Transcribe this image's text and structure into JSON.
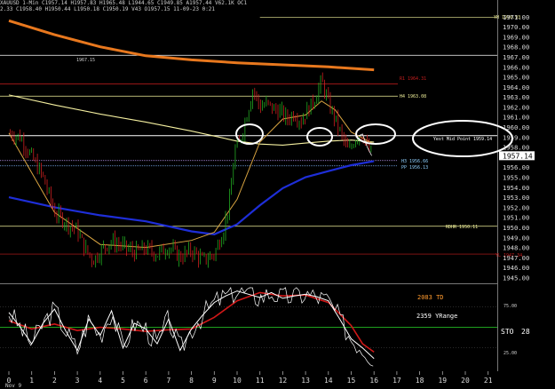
{
  "header": {
    "line1": "XAUUSD 1-Min C1957.14 H1957.83 H1965.48 L1944.65 C1949.85 A1957.44 V62.1K OC1",
    "line2": "2.33 C1958.40 H1950.44 L1950.18 C1950.19 V43 O1957.15 11-09-23 0:21"
  },
  "price_axis": {
    "ticks": [
      "1971.00",
      "1970.00",
      "1969.00",
      "1968.00",
      "1967.00",
      "1966.00",
      "1965.00",
      "1964.00",
      "1963.00",
      "1962.00",
      "1961.00",
      "1960.00",
      "1959.00",
      "1958.00",
      "1957.14",
      "1956.00",
      "1955.00",
      "1954.00",
      "1953.00",
      "1952.00",
      "1951.00",
      "1950.00",
      "1949.00",
      "1948.00",
      "1947.00",
      "1946.00",
      "1945.00"
    ],
    "current": "1957.14"
  },
  "levels": {
    "yh": "YH 1970.93",
    "r1": "R1 1964.31",
    "h4": "H4 1963.08",
    "h3": "H3 1956.66",
    "pp": "PP 1956.13",
    "rdhr": "RDHR 1950.11",
    "yl": "YL 1947.34",
    "annot_left": "1967.15"
  },
  "callouts": {
    "mid_point": "Yest Mid Point 1959.14"
  },
  "oscillator": {
    "td": "2083 TD",
    "range": "2359 YRange",
    "label": "STO",
    "label_suffix": "28",
    "ticks": [
      "75.00",
      "25.00"
    ]
  },
  "time_axis": {
    "ticks": [
      "0",
      "1",
      "2",
      "3",
      "4",
      "5",
      "6",
      "7",
      "8",
      "9",
      "10",
      "11",
      "12",
      "13",
      "14",
      "15",
      "16",
      "17",
      "18",
      "19",
      "20",
      "21"
    ],
    "bottom_label": "Nov 9"
  },
  "colors": {
    "background": "#000000",
    "price": "#ffffff",
    "up_bar": "#22aa22",
    "down_bar": "#cc2020",
    "ma_orange": "#e8781e",
    "ma_yellow": "#f5f0a0",
    "ma_blue": "#1e2ed8",
    "sma_gold": "#d9a441",
    "level_red": "#c81e1e",
    "level_yellow": "#f0f09a",
    "level_white": "#ffffff",
    "grid": "#1a1a1a",
    "stoch_k": "#ffffff",
    "stoch_d": "#d01818",
    "td_text": "#ff9a2e"
  },
  "chart_data": {
    "type": "line",
    "title": "",
    "xlabel": "",
    "ylabel": "",
    "y_range": [
      1944.6,
      1971.6
    ],
    "x_range": [
      0,
      22
    ],
    "close": [
      [
        0,
        1959.4
      ],
      [
        0.5,
        1959.0
      ],
      [
        1,
        1957.0
      ],
      [
        1.5,
        1955.0
      ],
      [
        2,
        1951.5
      ],
      [
        2.5,
        1950.5
      ],
      [
        3,
        1949.7
      ],
      [
        3.3,
        1948.0
      ],
      [
        3.7,
        1946.7
      ],
      [
        4.1,
        1947.9
      ],
      [
        4.5,
        1948.6
      ],
      [
        5,
        1948.1
      ],
      [
        5.5,
        1947.5
      ],
      [
        6,
        1947.9
      ],
      [
        6.5,
        1947.3
      ],
      [
        7,
        1948.1
      ],
      [
        7.5,
        1947.0
      ],
      [
        8,
        1947.7
      ],
      [
        8.5,
        1946.7
      ],
      [
        9,
        1947.3
      ],
      [
        9.4,
        1949.7
      ],
      [
        9.7,
        1953.0
      ],
      [
        9.9,
        1957.8
      ],
      [
        10.1,
        1958.4
      ],
      [
        10.4,
        1961.0
      ],
      [
        10.7,
        1963.8
      ],
      [
        11,
        1962.0
      ],
      [
        11.3,
        1962.3
      ],
      [
        11.6,
        1961.8
      ],
      [
        11.9,
        1961.5
      ],
      [
        12.2,
        1960.8
      ],
      [
        12.5,
        1961.4
      ],
      [
        12.8,
        1960.6
      ],
      [
        13.1,
        1961.7
      ],
      [
        13.4,
        1962.8
      ],
      [
        13.7,
        1964.6
      ],
      [
        14.0,
        1962.4
      ],
      [
        14.3,
        1960.8
      ],
      [
        14.6,
        1959.0
      ],
      [
        14.9,
        1957.5
      ],
      [
        15.2,
        1959.0
      ],
      [
        15.5,
        1959.3
      ],
      [
        15.7,
        1958.0
      ],
      [
        15.9,
        1957.14
      ]
    ],
    "moving_averages": [
      {
        "name": "orange",
        "values": [
          [
            0,
            1970.6
          ],
          [
            2,
            1969.2
          ],
          [
            4,
            1968.0
          ],
          [
            6,
            1967.1
          ],
          [
            8,
            1966.7
          ],
          [
            10,
            1966.4
          ],
          [
            12,
            1966.2
          ],
          [
            14,
            1966.0
          ],
          [
            16,
            1965.7
          ]
        ]
      },
      {
        "name": "yellow",
        "values": [
          [
            0,
            1963.2
          ],
          [
            2,
            1962.2
          ],
          [
            4,
            1961.3
          ],
          [
            6,
            1960.5
          ],
          [
            8,
            1959.6
          ],
          [
            9,
            1959.1
          ],
          [
            10,
            1958.6
          ],
          [
            11,
            1958.3
          ],
          [
            12,
            1958.2
          ],
          [
            13,
            1958.4
          ],
          [
            14,
            1958.6
          ],
          [
            15,
            1958.7
          ],
          [
            16,
            1958.5
          ]
        ]
      },
      {
        "name": "blue",
        "values": [
          [
            0,
            1953.0
          ],
          [
            2,
            1952.0
          ],
          [
            4,
            1951.2
          ],
          [
            6,
            1950.6
          ],
          [
            8,
            1949.6
          ],
          [
            9,
            1949.3
          ],
          [
            10,
            1950.3
          ],
          [
            11,
            1952.2
          ],
          [
            12,
            1953.9
          ],
          [
            13,
            1955.0
          ],
          [
            14,
            1955.6
          ],
          [
            15,
            1956.2
          ],
          [
            16,
            1956.6
          ]
        ]
      },
      {
        "name": "gold",
        "values": [
          [
            0,
            1959.4
          ],
          [
            2,
            1951.5
          ],
          [
            4,
            1948.3
          ],
          [
            6,
            1948.0
          ],
          [
            8,
            1948.7
          ],
          [
            9,
            1949.5
          ],
          [
            10,
            1952.8
          ],
          [
            11,
            1958.5
          ],
          [
            12,
            1960.8
          ],
          [
            13,
            1961.2
          ],
          [
            13.7,
            1962.6
          ],
          [
            14.3,
            1961.7
          ],
          [
            15,
            1959.5
          ],
          [
            16,
            1958.3
          ]
        ]
      }
    ],
    "levels": [
      {
        "name": "YH",
        "value": 1970.93
      },
      {
        "name": "R1",
        "value": 1964.31
      },
      {
        "name": "H4",
        "value": 1963.08
      },
      {
        "name": "Yest Mid Point",
        "value": 1959.14
      },
      {
        "name": "H3",
        "value": 1956.66
      },
      {
        "name": "PP",
        "value": 1956.13
      },
      {
        "name": "RDHR",
        "value": 1950.11
      },
      {
        "name": "YL",
        "value": 1947.34
      },
      {
        "name": "1967.15",
        "value": 1967.15
      }
    ],
    "stochastic": {
      "k": [
        [
          0,
          68
        ],
        [
          0.5,
          50
        ],
        [
          1,
          30
        ],
        [
          1.5,
          55
        ],
        [
          2,
          72
        ],
        [
          2.5,
          45
        ],
        [
          3,
          22
        ],
        [
          3.5,
          60
        ],
        [
          4,
          40
        ],
        [
          4.5,
          70
        ],
        [
          5,
          25
        ],
        [
          5.5,
          55
        ],
        [
          6,
          48
        ],
        [
          6.5,
          30
        ],
        [
          7,
          60
        ],
        [
          7.5,
          22
        ],
        [
          8,
          48
        ],
        [
          8.5,
          65
        ],
        [
          9,
          80
        ],
        [
          9.5,
          88
        ],
        [
          10,
          94
        ],
        [
          10.5,
          90
        ],
        [
          11,
          86
        ],
        [
          11.5,
          92
        ],
        [
          12,
          85
        ],
        [
          12.5,
          88
        ],
        [
          13,
          90
        ],
        [
          13.5,
          87
        ],
        [
          14,
          82
        ],
        [
          14.5,
          60
        ],
        [
          15,
          36
        ],
        [
          15.5,
          25
        ],
        [
          16,
          12
        ]
      ],
      "d": [
        [
          0,
          58
        ],
        [
          1,
          48
        ],
        [
          2,
          54
        ],
        [
          3,
          46
        ],
        [
          4,
          50
        ],
        [
          5,
          48
        ],
        [
          6,
          45
        ],
        [
          7,
          47
        ],
        [
          8,
          48
        ],
        [
          9,
          62
        ],
        [
          10,
          82
        ],
        [
          11,
          92
        ],
        [
          12,
          88
        ],
        [
          13,
          89
        ],
        [
          14,
          80
        ],
        [
          15,
          52
        ],
        [
          15.5,
          30
        ],
        [
          16,
          20
        ]
      ]
    }
  }
}
